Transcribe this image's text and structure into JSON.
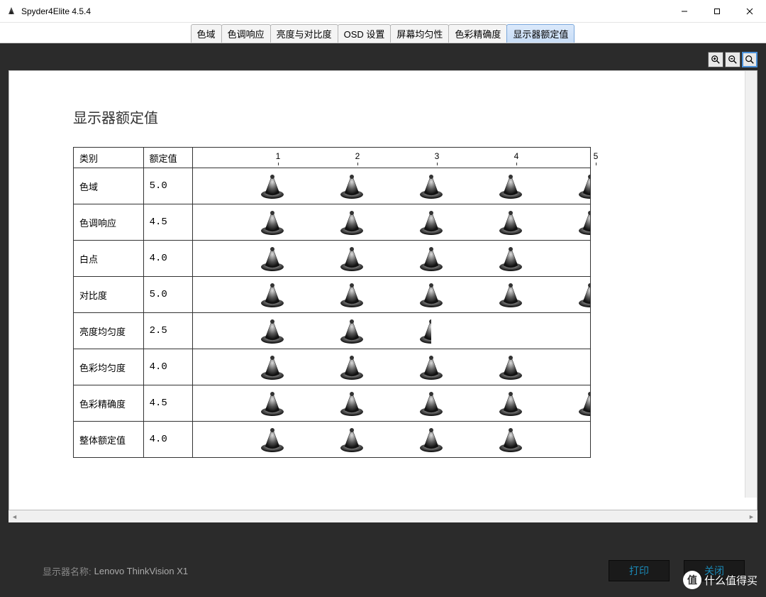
{
  "window": {
    "title": "Spyder4Elite 4.5.4"
  },
  "tabs": [
    {
      "label": "色域",
      "active": false
    },
    {
      "label": "色调响应",
      "active": false
    },
    {
      "label": "亮度与对比度",
      "active": false
    },
    {
      "label": "OSD 设置",
      "active": false
    },
    {
      "label": "屏幕均匀性",
      "active": false
    },
    {
      "label": "色彩精确度",
      "active": false
    },
    {
      "label": "显示器额定值",
      "active": true
    }
  ],
  "page": {
    "title": "显示器额定值",
    "table_headers": {
      "category": "类别",
      "rating": "额定值"
    },
    "scale_ticks": [
      "1",
      "2",
      "3",
      "4",
      "5"
    ],
    "rows": [
      {
        "category": "色域",
        "rating": "5.0",
        "value": 5.0
      },
      {
        "category": "色调响应",
        "rating": "4.5",
        "value": 4.5
      },
      {
        "category": "白点",
        "rating": "4.0",
        "value": 4.0
      },
      {
        "category": "对比度",
        "rating": "5.0",
        "value": 5.0
      },
      {
        "category": "亮度均匀度",
        "rating": "2.5",
        "value": 2.5
      },
      {
        "category": "色彩均匀度",
        "rating": "4.0",
        "value": 4.0
      },
      {
        "category": "色彩精确度",
        "rating": "4.5",
        "value": 4.5
      },
      {
        "category": "整体额定值",
        "rating": "4.0",
        "value": 4.0
      }
    ]
  },
  "status": {
    "label": "显示器名称:",
    "monitor_name": "Lenovo ThinkVision X1"
  },
  "buttons": {
    "print": "打印",
    "close": "关闭"
  },
  "watermark": {
    "badge": "值",
    "text": "什么值得买"
  },
  "chart_data": {
    "type": "bar",
    "title": "显示器额定值",
    "categories": [
      "色域",
      "色调响应",
      "白点",
      "对比度",
      "亮度均匀度",
      "色彩均匀度",
      "色彩精确度",
      "整体额定值"
    ],
    "values": [
      5.0,
      4.5,
      4.0,
      5.0,
      2.5,
      4.0,
      4.5,
      4.0
    ],
    "xlabel": "",
    "ylabel": "额定值",
    "ylim": [
      0,
      5
    ]
  }
}
